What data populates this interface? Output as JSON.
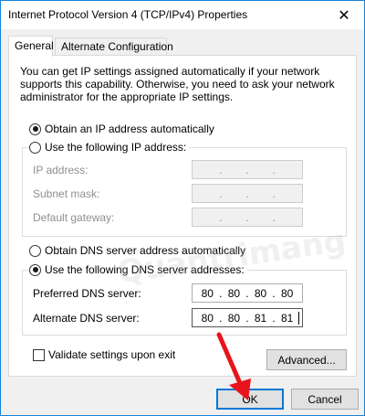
{
  "window": {
    "title": "Internet Protocol Version 4 (TCP/IPv4) Properties",
    "close_glyph": "✕"
  },
  "tabs": [
    {
      "label": "General",
      "active": true
    },
    {
      "label": "Alternate Configuration",
      "active": false
    }
  ],
  "description": "You can get IP settings assigned automatically if your network supports this capability. Otherwise, you need to ask your network administrator for the appropriate IP settings.",
  "ip_settings": {
    "auto_label": "Obtain an IP address automatically",
    "auto_selected": true,
    "manual_label": "Use the following IP address:",
    "manual_selected": false,
    "fields": [
      {
        "label": "IP address:",
        "value": [
          "",
          "",
          "",
          ""
        ]
      },
      {
        "label": "Subnet mask:",
        "value": [
          "",
          "",
          "",
          ""
        ]
      },
      {
        "label": "Default gateway:",
        "value": [
          "",
          "",
          "",
          ""
        ]
      }
    ]
  },
  "dns_settings": {
    "auto_label": "Obtain DNS server address automatically",
    "auto_selected": false,
    "manual_label": "Use the following DNS server addresses:",
    "manual_selected": true,
    "preferred_label": "Preferred DNS server:",
    "preferred_value": [
      "80",
      "80",
      "80",
      "80"
    ],
    "alternate_label": "Alternate DNS server:",
    "alternate_value": [
      "80",
      "80",
      "81",
      "81"
    ]
  },
  "validate_label": "Validate settings upon exit",
  "validate_checked": false,
  "buttons": {
    "advanced": "Advanced...",
    "ok": "OK",
    "cancel": "Cancel"
  },
  "watermark": "Quantrimang",
  "colors": {
    "accent": "#0078d7",
    "arrow": "#e8141c"
  }
}
